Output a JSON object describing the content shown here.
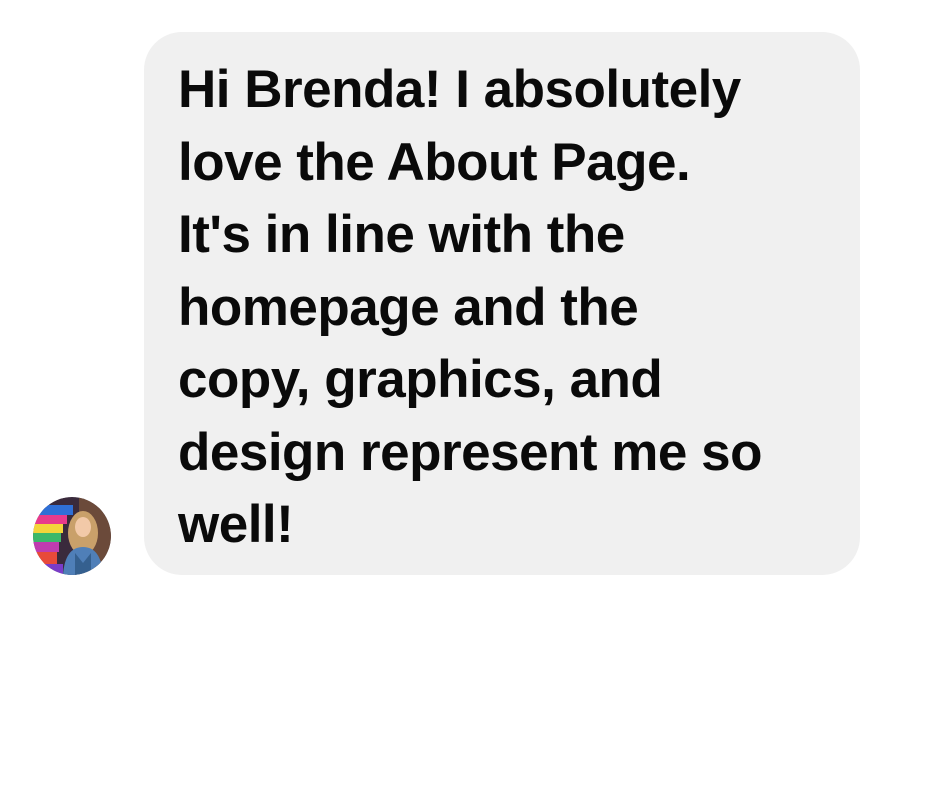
{
  "message": {
    "text": "Hi Brenda! I absolutely\nlove the About Page.\nIt's in line with the\nhomepage and the\ncopy, graphics, and\ndesign represent me so\nwell!",
    "bubble_color": "#f0f0f0",
    "text_color": "#0a0a0a"
  },
  "sender": {
    "avatar_icon": "profile-photo-avatar"
  }
}
